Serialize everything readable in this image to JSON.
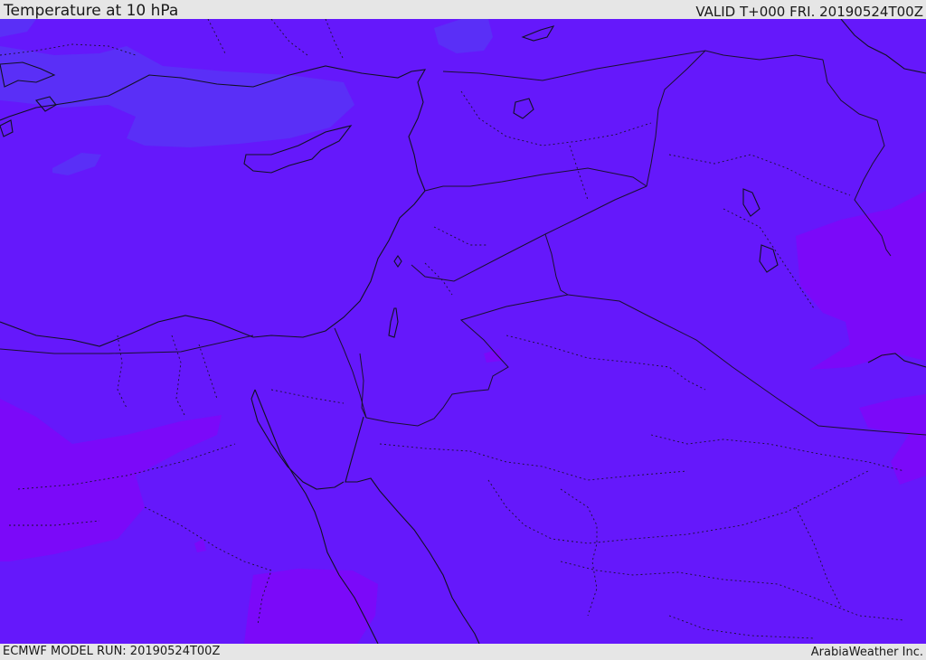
{
  "header": {
    "title": "Temperature at 10 hPa",
    "valid": "VALID T+000 FRI. 20190524T00Z"
  },
  "footer": {
    "model_run": "ECMWF MODEL RUN: 20190524T00Z",
    "credit": "ArabiaWeather Inc."
  },
  "map": {
    "field": "temperature",
    "colors": {
      "base": "#6518fb",
      "cooler": "#5a2ff7",
      "warmer": "#7b09f9",
      "coast": "#111122",
      "border": "#1a1030"
    }
  }
}
